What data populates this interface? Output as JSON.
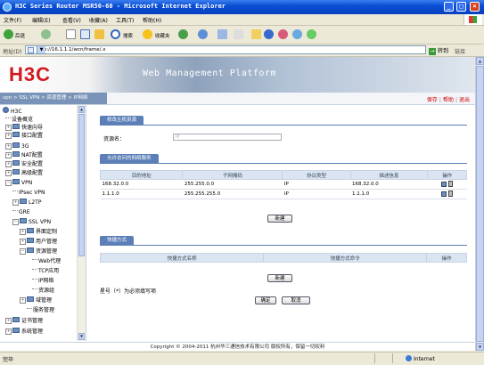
{
  "window": {
    "title": "H3C Series Router MSR50-60 - Microsoft Internet Explorer"
  },
  "menu": [
    "文件(F)",
    "编辑(E)",
    "查看(V)",
    "收藏(A)",
    "工具(T)",
    "帮助(H)"
  ],
  "toolbar": {
    "back": "后退",
    "search": "搜索",
    "favorites": "收藏夹"
  },
  "address": {
    "label": "地址(D)",
    "url": "http://16.1.1.1/wcn/frame/.x",
    "go": "转到",
    "links": "链接"
  },
  "banner": {
    "logo": "H3C",
    "title": "Web Management Platform"
  },
  "nav": {
    "breadcrumb": "vpn > SSL VPN > 资源管理 > IP网络",
    "links": [
      "保存",
      "帮助",
      "退出"
    ]
  },
  "sidebar": {
    "items": [
      {
        "label": "H3C",
        "type": "root"
      },
      {
        "label": "设备概览",
        "type": "leaf"
      },
      {
        "label": "快速向导",
        "type": "folder"
      },
      {
        "label": "接口配置",
        "type": "folder"
      },
      {
        "label": "3G",
        "type": "folder"
      },
      {
        "label": "NAT配置",
        "type": "folder"
      },
      {
        "label": "安全配置",
        "type": "folder"
      },
      {
        "label": "高级配置",
        "type": "folder"
      },
      {
        "label": "VPN",
        "type": "folder-open"
      },
      {
        "label": "IPsec VPN",
        "type": "leaf"
      },
      {
        "label": "L2TP",
        "type": "folder"
      },
      {
        "label": "GRE",
        "type": "leaf"
      },
      {
        "label": "SSL VPN",
        "type": "folder-open"
      },
      {
        "label": "界面定制",
        "type": "folder"
      },
      {
        "label": "用户管理",
        "type": "folder"
      },
      {
        "label": "资源管理",
        "type": "folder-open"
      },
      {
        "label": "Web代理",
        "type": "leaf"
      },
      {
        "label": "TCP应用",
        "type": "leaf"
      },
      {
        "label": "IP网络",
        "type": "leaf"
      },
      {
        "label": "资源组",
        "type": "leaf"
      },
      {
        "label": "域管理",
        "type": "folder"
      },
      {
        "label": "服务管理",
        "type": "leaf"
      },
      {
        "label": "证书管理",
        "type": "folder"
      },
      {
        "label": "系统管理",
        "type": "folder"
      }
    ]
  },
  "host_section": {
    "tab": "修改主机资源",
    "name_label": "资源名：",
    "name_value": "IP"
  },
  "networks_section": {
    "tab": "允许访问的网络服务",
    "columns": [
      "目的地址",
      "子网掩码",
      "协议类型",
      "描述信息",
      "操作"
    ],
    "rows": [
      [
        "168.32.0.0",
        "255.255.0.0",
        "IP",
        "168.32.0.0"
      ],
      [
        "1.1.1.0",
        "255.255.255.0",
        "IP",
        "1.1.1.0"
      ]
    ],
    "new_button": "新建"
  },
  "shortcut_section": {
    "tab": "快捷方式",
    "columns": [
      "快捷方式名称",
      "快捷方式命令",
      "操作"
    ],
    "new_button": "新建"
  },
  "required_note": "星号（*）为必须填写项",
  "buttons": {
    "ok": "确定",
    "cancel": "取消"
  },
  "footer": "Copyright © 2004-2011 杭州华三通信技术有限公司 版权所有，保留一切权利",
  "status": {
    "left": "完毕",
    "zone": "Internet"
  },
  "colors": {
    "title_bar": "#0a4fd4",
    "tab_blue": "#5b7fb6",
    "logo_red": "#d01920",
    "link_red": "#cc0000"
  }
}
